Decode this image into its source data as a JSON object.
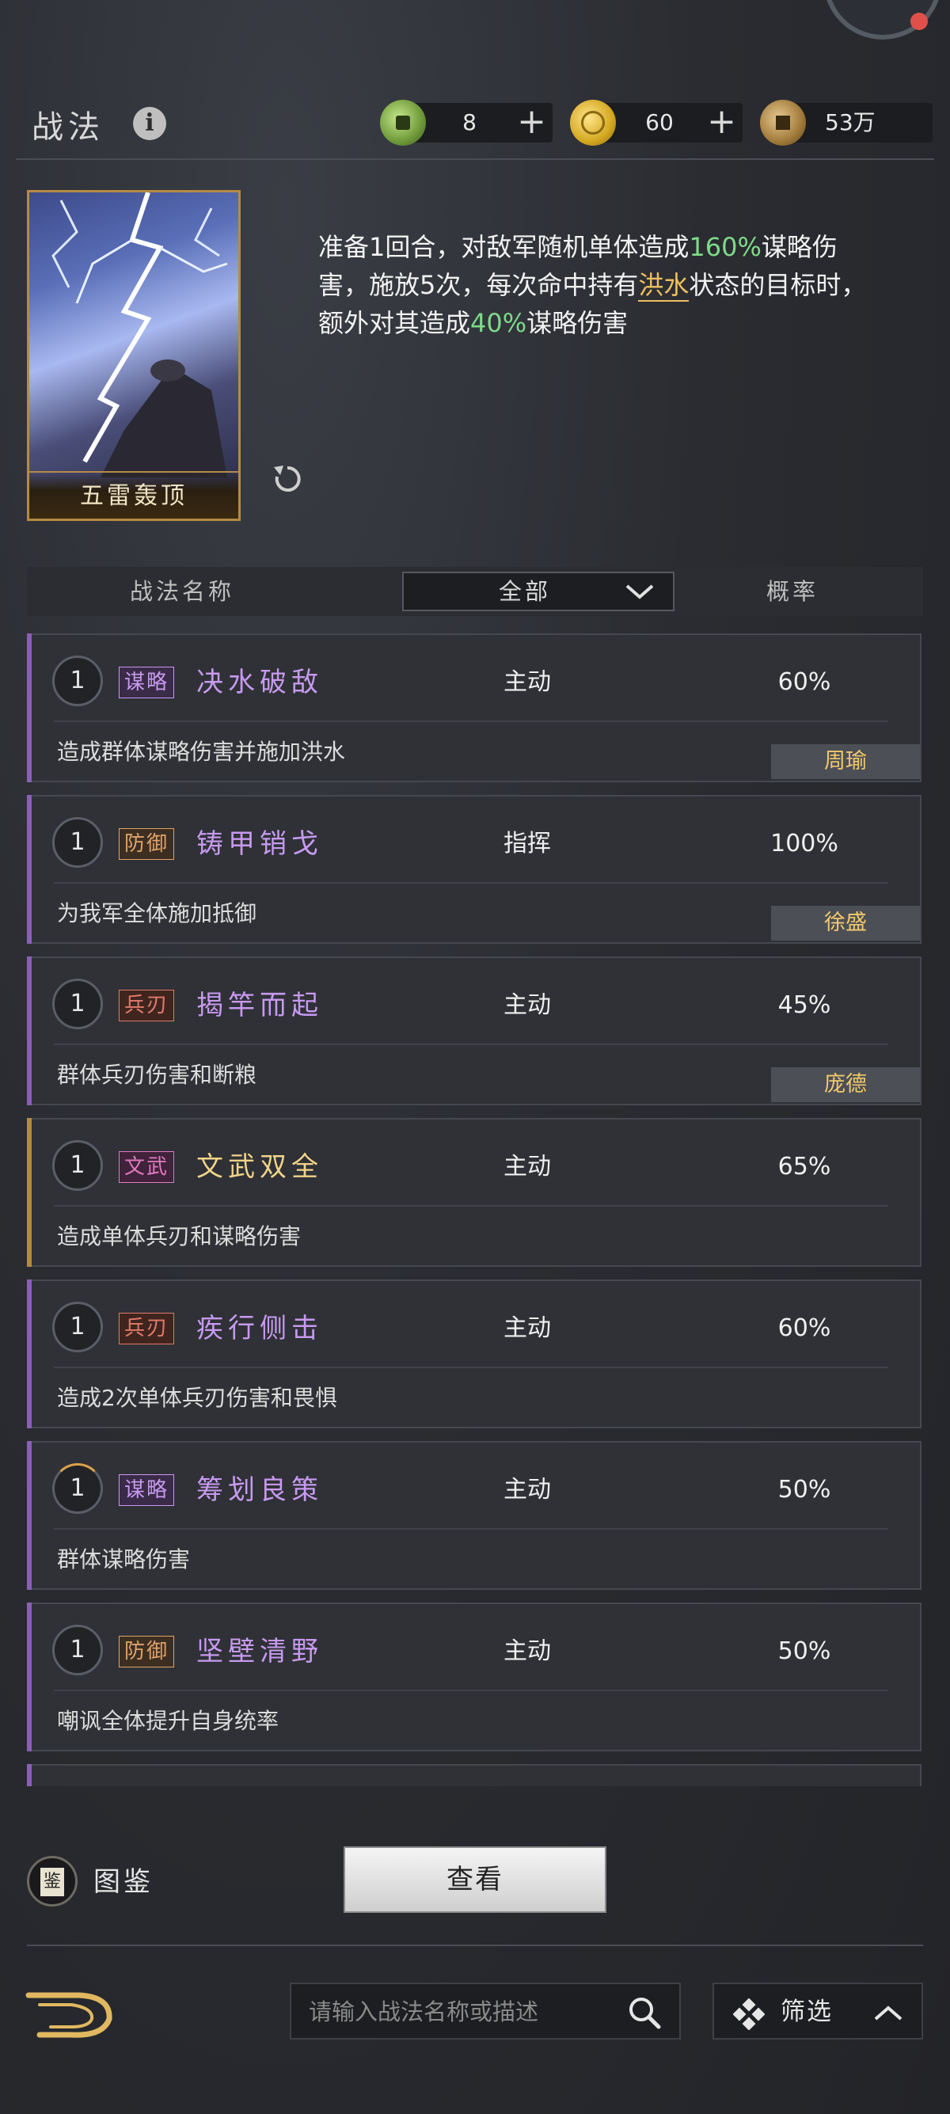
{
  "header": {
    "title": "战法",
    "info_icon": "info-icon",
    "resources": [
      {
        "icon": "jade-coin-icon",
        "value": "8",
        "plus": "+"
      },
      {
        "icon": "gold-coin-icon",
        "value": "60",
        "plus": "+"
      },
      {
        "icon": "copper-coin-icon",
        "value": "53万"
      }
    ]
  },
  "featured": {
    "card_name": "五雷轰顶",
    "desc_parts": [
      "准备1回合，对敌军随机单体造成",
      "160%",
      "谋略伤害，施放5次，每次命中持有",
      "洪水",
      "状态的目标时，额外对其造成",
      "40%",
      "谋略伤害"
    ]
  },
  "table": {
    "col_name": "战法名称",
    "filter_value": "全部",
    "col_prob": "概率"
  },
  "skills": [
    {
      "level": "1",
      "tag": "谋略",
      "name": "决水破敌",
      "type": "主动",
      "prob": "60%",
      "desc": "造成群体谋略伤害并施加洪水",
      "hero": "周瑜"
    },
    {
      "level": "1",
      "tag": "防御",
      "name": "铸甲销戈",
      "type": "指挥",
      "prob": "100%",
      "desc": "为我军全体施加抵御",
      "hero": "徐盛"
    },
    {
      "level": "1",
      "tag": "兵刃",
      "name": "揭竿而起",
      "type": "主动",
      "prob": "45%",
      "desc": "群体兵刃伤害和断粮",
      "hero": "庞德"
    },
    {
      "level": "1",
      "tag": "文武",
      "name": "文武双全",
      "type": "主动",
      "prob": "65%",
      "desc": "造成单体兵刃和谋略伤害",
      "hero": ""
    },
    {
      "level": "1",
      "tag": "兵刃",
      "name": "疾行侧击",
      "type": "主动",
      "prob": "60%",
      "desc": "造成2次单体兵刃伤害和畏惧",
      "hero": ""
    },
    {
      "level": "1",
      "tag": "谋略",
      "name": "筹划良策",
      "type": "主动",
      "prob": "50%",
      "desc": "群体谋略伤害",
      "hero": ""
    },
    {
      "level": "1",
      "tag": "防御",
      "name": "坚壁清野",
      "type": "主动",
      "prob": "50%",
      "desc": "嘲讽全体提升自身统率",
      "hero": ""
    }
  ],
  "bottom": {
    "tujian_icon_char": "鉴",
    "tujian_label": "图鉴",
    "view_button": "查看",
    "search_placeholder": "请输入战法名称或描述",
    "filter_label": "筛选"
  },
  "colors": {
    "accent_gold": "#f1c96a",
    "highlight_green": "#7fd98a",
    "strategy_purple": "#c79af0"
  }
}
